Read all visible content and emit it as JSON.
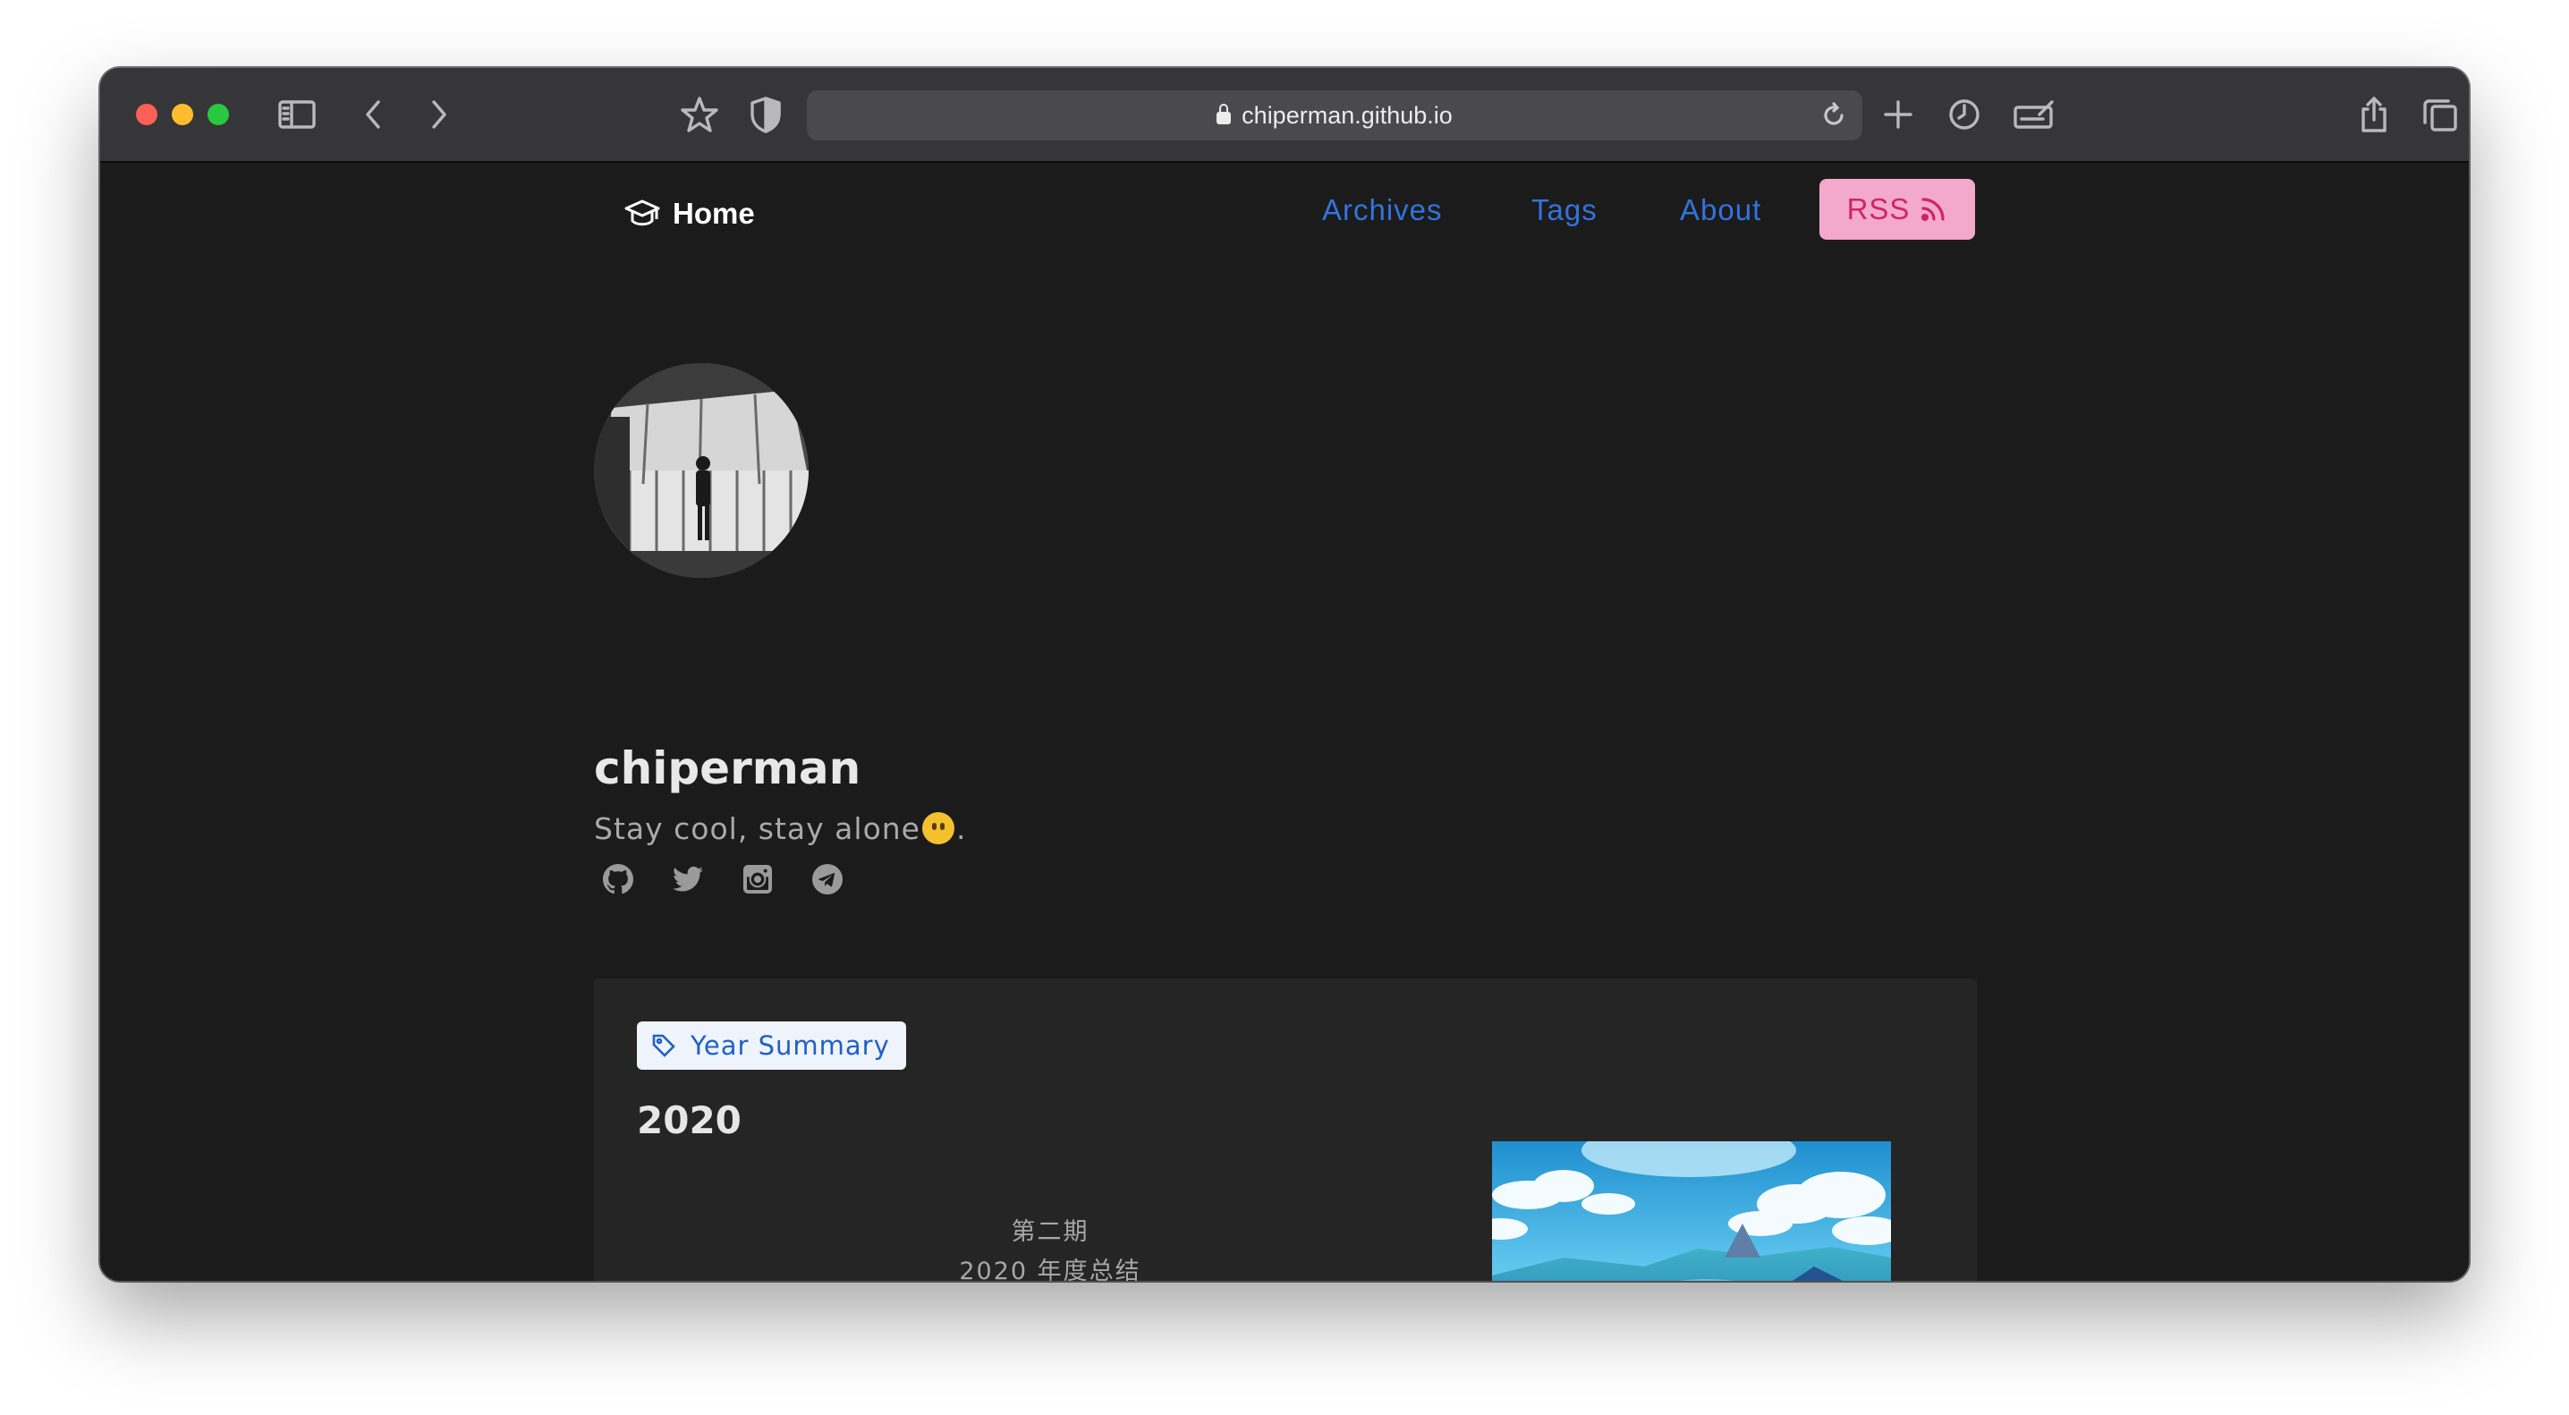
{
  "browser": {
    "url": "chiperman.github.io"
  },
  "nav": {
    "home_label": "Home",
    "links": [
      "Archives",
      "Tags",
      "About"
    ],
    "rss_label": "RSS",
    "link_color": "#3273dc",
    "rss_bg": "#f3a9cc"
  },
  "profile": {
    "name": "chiperman",
    "bio_text": "Stay cool, stay alone",
    "bio_suffix": ".",
    "social_icons": [
      "github-icon",
      "twitter-icon",
      "instagram-icon",
      "telegram-icon"
    ]
  },
  "post": {
    "tag": "Year Summary",
    "title": "2020",
    "excerpt_line1": "第二期",
    "excerpt_line2": "2020 年度总结"
  }
}
